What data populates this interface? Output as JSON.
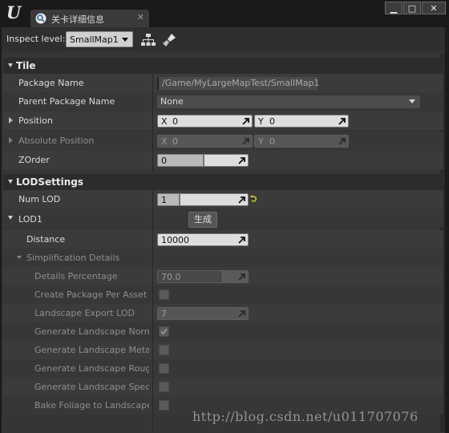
{
  "window": {
    "tab_title": "关卡详细信息",
    "tab_close": "✕",
    "buttons": {
      "minimize": "▁",
      "maximize": "□",
      "close": "✕"
    }
  },
  "toolbar": {
    "inspect_label": "Inspect level:",
    "level_value": "SmallMap1",
    "icons": [
      "hierarchy-icon",
      "brush-icon"
    ]
  },
  "categories": {
    "tile": "Tile",
    "lod": "LODSettings"
  },
  "tile": {
    "package_name": {
      "label": "Package Name",
      "value": "/Game/MyLargeMapTest/SmallMap1"
    },
    "parent_package": {
      "label": "Parent Package Name",
      "value": "None"
    },
    "position": {
      "label": "Position",
      "x_axis": "X",
      "x": "0",
      "y_axis": "Y",
      "y": "0"
    },
    "absolute_position": {
      "label": "Absolute Position",
      "x_axis": "X",
      "x": "0",
      "y_axis": "Y",
      "y": "0"
    },
    "zorder": {
      "label": "ZOrder",
      "value": "0",
      "fill": 0.5
    }
  },
  "lod": {
    "num_lod": {
      "label": "Num LOD",
      "value": "1",
      "fill": 0.23
    },
    "lod1": {
      "label": "LOD1",
      "generate_button": "生成"
    },
    "distance": {
      "label": "Distance",
      "value": "10000"
    },
    "simplification": {
      "label": "Simplification Details"
    },
    "details_percentage": {
      "label": "Details Percentage",
      "value": "70.0",
      "fill": 0.7
    },
    "create_package": {
      "label": "Create Package Per Asset",
      "checked": false
    },
    "landscape_export_lod": {
      "label": "Landscape Export LOD",
      "value": "7"
    },
    "gen_normal": {
      "label": "Generate Landscape Normal M",
      "checked": true
    },
    "gen_metallic": {
      "label": "Generate Landscape Metallic",
      "checked": false
    },
    "gen_roughness": {
      "label": "Generate Landscape Roughne",
      "checked": false
    },
    "gen_specular": {
      "label": "Generate Landscape Specular",
      "checked": false
    },
    "bake_foliage": {
      "label": "Bake Foliage to Landscape",
      "checked": false
    }
  },
  "watermark": "http://blog.csdn.net/u011707076",
  "colors": {
    "panel": "#353535",
    "row": "#3b3b3b",
    "category": "#2c2c2c",
    "field": "#dedede"
  }
}
